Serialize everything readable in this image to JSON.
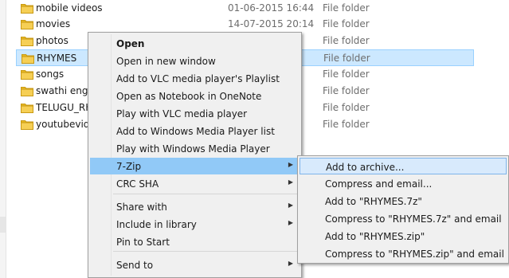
{
  "files": [
    {
      "name": "mobile videos",
      "date": "01-06-2015 16:44",
      "type": "File folder",
      "selected": false
    },
    {
      "name": "movies",
      "date": "14-07-2015 20:14",
      "type": "File folder",
      "selected": false
    },
    {
      "name": "photos",
      "date": "",
      "type": "File folder",
      "selected": false
    },
    {
      "name": "RHYMES",
      "date": "",
      "type": "File folder",
      "selected": true
    },
    {
      "name": "songs",
      "date": "",
      "type": "File folder",
      "selected": false
    },
    {
      "name": "swathi engag",
      "date": "",
      "type": "File folder",
      "selected": false
    },
    {
      "name": "TELUGU_RH",
      "date": "",
      "type": "File folder",
      "selected": false
    },
    {
      "name": "youtubevide",
      "date": "",
      "type": "File folder",
      "selected": false
    }
  ],
  "context_menu": {
    "items": [
      {
        "label": "Open",
        "bold": true
      },
      {
        "label": "Open in new window"
      },
      {
        "label": "Add to VLC media player's Playlist"
      },
      {
        "label": "Open as Notebook in OneNote"
      },
      {
        "label": "Play with VLC media player"
      },
      {
        "label": "Add to Windows Media Player list"
      },
      {
        "label": "Play with Windows Media Player"
      },
      {
        "label": "7-Zip",
        "submenu": true,
        "highlighted": true
      },
      {
        "label": "CRC SHA",
        "submenu": true
      },
      {
        "label": "Share with",
        "submenu": true
      },
      {
        "label": "Include in library",
        "submenu": true
      },
      {
        "label": "Pin to Start"
      },
      {
        "label": "Send to",
        "submenu": true
      }
    ]
  },
  "zip_submenu": {
    "items": [
      {
        "label": "Add to archive...",
        "highlighted": true
      },
      {
        "label": "Compress and email..."
      },
      {
        "label": "Add to \"RHYMES.7z\""
      },
      {
        "label": "Compress to \"RHYMES.7z\" and email"
      },
      {
        "label": "Add to \"RHYMES.zip\""
      },
      {
        "label": "Compress to \"RHYMES.zip\" and email"
      }
    ]
  },
  "colors": {
    "folder_yellow": "#e8b923",
    "selection_fill": "#cce8ff",
    "menu_highlight": "#91c9f7",
    "menu_background": "#f0f0f0"
  },
  "icons": {
    "folder": "folder-icon",
    "submenu_arrow": "submenu-arrow-icon"
  }
}
